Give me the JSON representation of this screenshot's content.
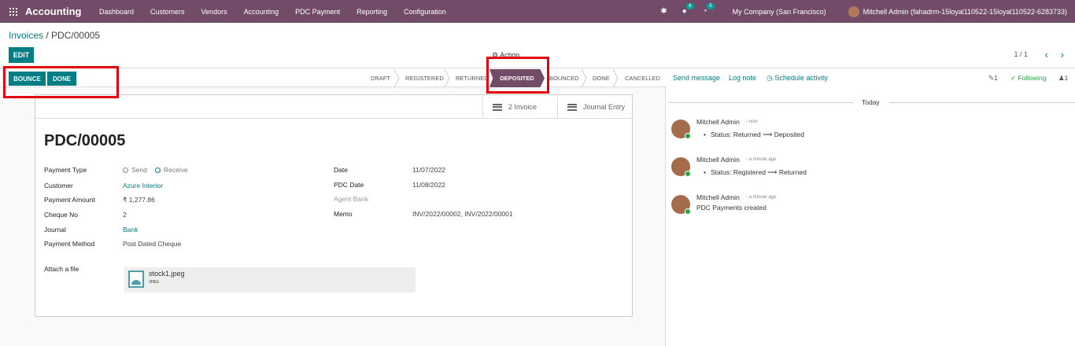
{
  "navbar": {
    "brand": "Accounting",
    "menu": [
      "Dashboard",
      "Customers",
      "Vendors",
      "Accounting",
      "PDC Payment",
      "Reporting",
      "Configuration"
    ],
    "messages_count": "6",
    "activities_count": "5",
    "company": "My Company (San Francisco)",
    "user": "Mitchell Admin (fahadrm-15loyal110522-15loyal110522-6283733)"
  },
  "control": {
    "breadcrumb_parent": "Invoices",
    "breadcrumb_sep": " / ",
    "breadcrumb_current": "PDC/00005",
    "edit_label": "EDIT",
    "action_label": "⚙ Action",
    "pager": "1 / 1"
  },
  "statusbar": {
    "bounce_label": "BOUNCE",
    "done_label": "DONE",
    "stages": [
      "DRAFT",
      "REGISTERED",
      "RETURNED",
      "DEPOSITED",
      "BOUNCED",
      "DONE",
      "CANCELLED"
    ],
    "active_stage": "DEPOSITED"
  },
  "smart_buttons": {
    "invoice_count": "2",
    "invoice_label": "Invoice",
    "journal_label": "Journal Entry"
  },
  "record": {
    "title": "PDC/00005",
    "payment_type_label": "Payment Type",
    "payment_type_send": "Send",
    "payment_type_receive": "Receive",
    "customer_label": "Customer",
    "customer": "Azure Interior",
    "amount_label": "Payment Amount",
    "amount": "₹ 1,277.86",
    "cheque_no_label": "Cheque No",
    "cheque_no": "2",
    "journal_label": "Journal",
    "journal": "Bank",
    "method_label": "Payment Method",
    "method": "Post Dated Cheque",
    "date_label": "Date",
    "date": "11/07/2022",
    "pdc_date_label": "PDC Date",
    "pdc_date": "11/08/2022",
    "agent_bank_label": "Agent Bank",
    "memo_label": "Memo",
    "memo": "INV/2022/00002, INV/2022/00001",
    "attach_label": "Attach a file",
    "file_name": "stock1.jpeg",
    "file_type": "JPEG"
  },
  "chatter": {
    "send_message": "Send message",
    "log_note": "Log note",
    "schedule_activity": "Schedule activity",
    "attachments_count": "1",
    "following": "Following",
    "followers_count": "1",
    "date_divider": "Today",
    "messages": [
      {
        "author": "Mitchell Admin",
        "time": "- now",
        "body": "Status: Returned ⟶ Deposited"
      },
      {
        "author": "Mitchell Admin",
        "time": "- a minute ago",
        "body": "Status: Registered ⟶ Returned"
      },
      {
        "author": "Mitchell Admin",
        "time": "- a minute ago",
        "body": "PDC Payments created"
      }
    ]
  },
  "colors": {
    "brand": "#714b67",
    "accent": "#017e84",
    "highlight": "#e3000f"
  }
}
